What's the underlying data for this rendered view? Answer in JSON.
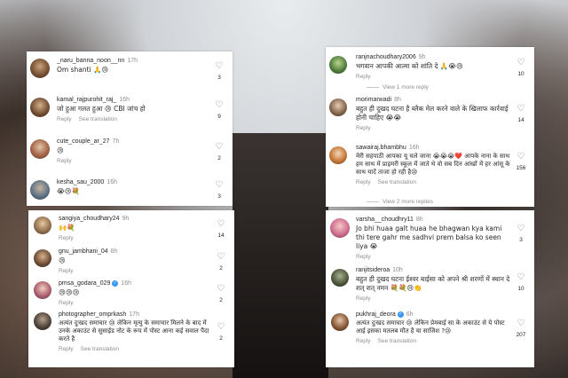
{
  "top_left": {
    "comments": [
      {
        "user": "_naru_banna_noon__nn",
        "time": "17h",
        "text": "Om shanti 🙏😢",
        "actions": [],
        "likes": "3"
      },
      {
        "user": "kamal_rajpurohit_raj_",
        "time": "16h",
        "text": "जो हुआ गलत हुआ 😢 CBI जांच हो",
        "actions": [
          "Reply",
          "See translation"
        ],
        "likes": "9"
      },
      {
        "user": "cute_couple_ar_27",
        "time": "7h",
        "text": "😢",
        "actions": [
          "Reply"
        ],
        "likes": "2"
      },
      {
        "user": "kesha_sau_2000",
        "time": "16h",
        "text": "😭😢💐",
        "actions": [],
        "likes": "3"
      }
    ]
  },
  "bottom_left": {
    "comments": [
      {
        "user": "sangiya_choudhary24",
        "time": "9h",
        "text": "🙌💐",
        "actions": [
          "Reply"
        ],
        "likes": "14"
      },
      {
        "user": "gnu_jambhani_04",
        "time": "8h",
        "text": "😢",
        "actions": [
          "Reply"
        ],
        "likes": "2"
      },
      {
        "user": "pmsa_godara_029",
        "time": "16h",
        "verified": true,
        "text": "😢😢😢",
        "actions": [
          "Reply"
        ],
        "likes": "2"
      },
      {
        "user": "photographer_omprkash",
        "time": "17h",
        "text": "अत्यंत दुःखद समाचार 😢 लेकिन मृत्यु के समाचार मिलने के बाद में उनके अकाउंट से सुसाईड नोट के रूप में पोस्ट आना कई सवाल पैदा करते है",
        "actions": [
          "Reply",
          "See translation"
        ],
        "likes": "2"
      }
    ]
  },
  "top_right": {
    "comments": [
      {
        "user": "ranjnachoudhary2006",
        "time": "9h",
        "text": "भगवान आपकी आत्मा को शांति दे 🙏😭😢",
        "actions": [
          "Reply"
        ],
        "likes": "10"
      },
      {
        "user": "morimarwadi",
        "time": "8h",
        "text": "बहुत ही दुखद घटना है ब्लैक मेल करने वाले के खिलाफ कार्रवाई होनी चाहिए 😭😭",
        "actions": [
          "Reply"
        ],
        "likes": "14"
      },
      {
        "user": "sawairaj.bhambhu",
        "time": "16h",
        "text": "मेरी सहपाठी आपका यू चले जाना 😭😭😭❤️ आपके नाना के साथ हम साथ में प्राइमरी स्कूल में जाते थे वो सब दिन आंखों में हर आंसू के साथ यादें ताजा हो रही है😢",
        "actions": [
          "Reply",
          "See translation"
        ],
        "likes": "156"
      }
    ],
    "view_more_1": "View 1 more reply",
    "view_more_2": "View 2 more replies"
  },
  "bottom_right": {
    "comments": [
      {
        "user": "varsha__choudhry11",
        "time": "8h",
        "text": "Jo bhi huaa galt huaa he bhagwan kya kami thi tere gahr me sadhvi prem balsa ko seen liya 😭",
        "actions": [
          "Reply"
        ],
        "likes": "3"
      },
      {
        "user": "ranjitsideroa",
        "time": "10h",
        "text": "बहुत ही दुखद घटना ईश्वर बाईसा को अपने श्री शरणों में स्थान दे शत् शत् नमन 💐💐😢👏",
        "actions": [
          "Reply"
        ],
        "likes": "10"
      },
      {
        "user": "pukhraj_deora",
        "time": "6h",
        "verified": true,
        "text": "अत्यंत दुःखद समाचार 😢 लेकिन प्रेमबाई सा के अकाउंट से ये पोस्ट आई इसका मतलब मौत है या साजिश ?😢",
        "actions": [
          "Reply",
          "See translation"
        ],
        "likes": "207"
      }
    ]
  }
}
